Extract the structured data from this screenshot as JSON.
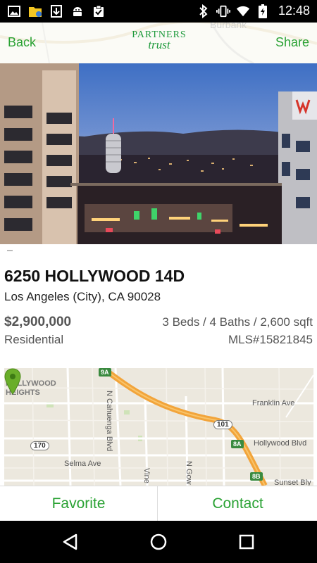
{
  "status_bar": {
    "time": "12:48",
    "left_icons": [
      "image-icon",
      "folder-icon",
      "download-icon",
      "android-icon",
      "clipboard-check-icon"
    ],
    "right_icons": [
      "bluetooth-icon",
      "vibrate-icon",
      "wifi-icon",
      "battery-charging-icon"
    ]
  },
  "header": {
    "back_label": "Back",
    "share_label": "Share",
    "brand_line1": "PARTNERS",
    "brand_line2": "trust",
    "map_ghost_label": "Burbank"
  },
  "listing": {
    "address": "6250 HOLLYWOOD 14D",
    "city": "Los Angeles (City), CA 90028",
    "price": "$2,900,000",
    "specs": "3 Beds / 4 Baths / 2,600 sqft",
    "property_type": "Residential",
    "mls": "MLS#15821845"
  },
  "map": {
    "area_label": "HOLLYWOOD\nHEIGHTS",
    "streets": {
      "franklin": "Franklin Ave",
      "hollywood": "Hollywood Blvd",
      "selma": "Selma Ave",
      "sunset": "Sunset Bly",
      "cahuenga": "N Cahuenga Blvd",
      "vine": "Vine",
      "gower": "N Gow"
    },
    "exit_shields": [
      "9A",
      "8A",
      "8B"
    ],
    "route_shields": [
      "101",
      "170"
    ]
  },
  "actions": {
    "favorite_label": "Favorite",
    "contact_label": "Contact"
  },
  "colors": {
    "accent": "#2aa234",
    "freeway": "#f2a43a",
    "pin": "#6aae2a"
  }
}
